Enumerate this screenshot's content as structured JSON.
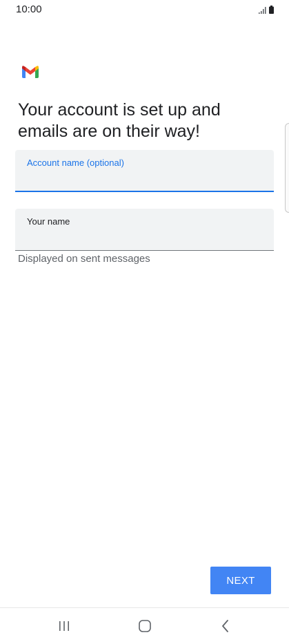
{
  "status_bar": {
    "time": "10:00",
    "signal_icon": "signal-icon",
    "battery_icon": "battery-icon"
  },
  "app": {
    "logo_icon": "gmail-logo-icon",
    "headline": "Your account is set up and emails are on their way!"
  },
  "form": {
    "account_name": {
      "label": "Account name (optional)",
      "value": ""
    },
    "your_name": {
      "label": "Your name",
      "value": "",
      "helper": "Displayed on sent messages"
    }
  },
  "actions": {
    "next_label": "NEXT"
  },
  "nav_bar": {
    "recents_icon": "recents-icon",
    "home_icon": "home-icon",
    "back_icon": "back-icon"
  },
  "colors": {
    "accent": "#1a73e8",
    "button": "#4285f4",
    "field_bg": "#f1f3f4"
  }
}
